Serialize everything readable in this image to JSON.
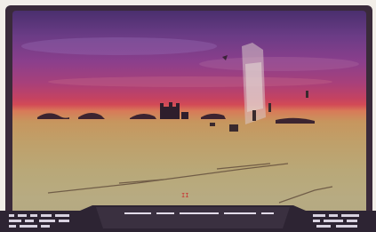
{
  "scene": {
    "type": "flight-simulator-cockpit-view",
    "sky_colors": [
      "#4a2f6e",
      "#8b3f8c",
      "#c44262",
      "#d87a58"
    ],
    "ground_color": "#bba67a",
    "horizon_color": "#d24a56",
    "bezel_color": "#3a2a3a"
  },
  "hud": {
    "marker_symbol": "II"
  }
}
